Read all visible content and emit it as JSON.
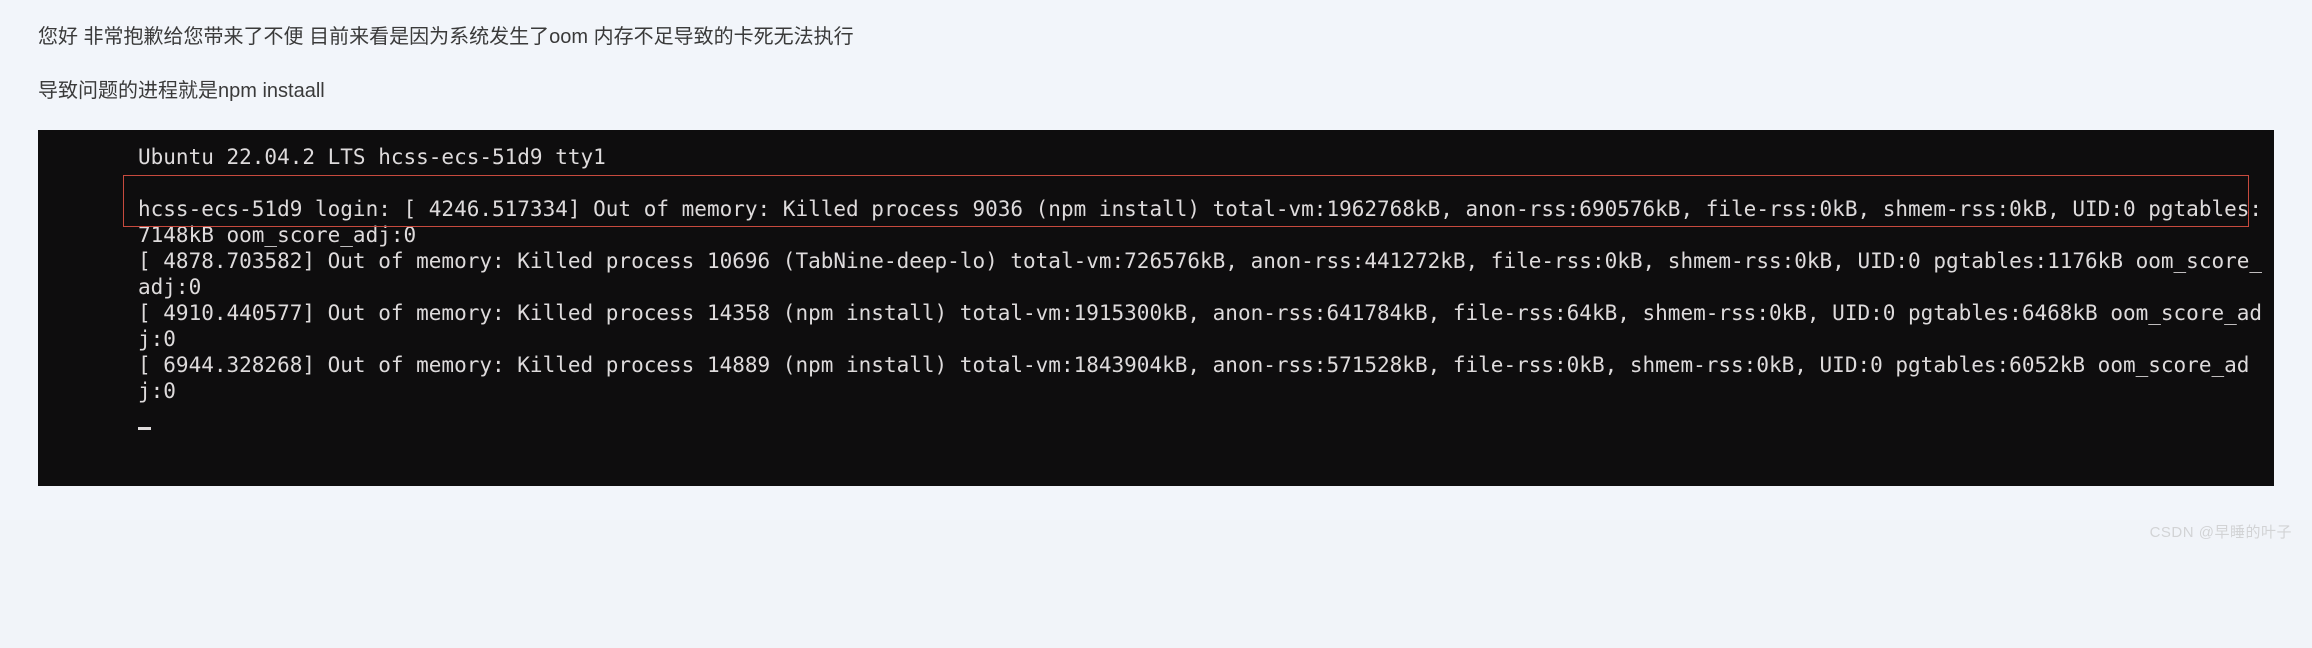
{
  "paragraphs": {
    "p1": "您好  非常抱歉给您带来了不便  目前来看是因为系统发生了oom  内存不足导致的卡死无法执行",
    "p2": "导致问题的进程就是npm instaall"
  },
  "terminal": {
    "l0": "Ubuntu 22.04.2 LTS hcss-ecs-51d9 tty1",
    "blank0": " ",
    "l1": "hcss-ecs-51d9 login: [ 4246.517334] Out of memory: Killed process 9036 (npm install) total-vm:1962768kB, anon-rss:690576kB, file-rss:0kB, shmem-rss:0kB, UID:0 pgtables:7148kB oom_score_adj:0",
    "l2": "[ 4878.703582] Out of memory: Killed process 10696 (TabNine-deep-lo) total-vm:726576kB, anon-rss:441272kB, file-rss:0kB, shmem-rss:0kB, UID:0 pgtables:1176kB oom_score_adj:0",
    "l3": "[ 4910.440577] Out of memory: Killed process 14358 (npm install) total-vm:1915300kB, anon-rss:641784kB, file-rss:64kB, shmem-rss:0kB, UID:0 pgtables:6468kB oom_score_adj:0",
    "l4": "[ 6944.328268] Out of memory: Killed process 14889 (npm install) total-vm:1843904kB, anon-rss:571528kB, file-rss:0kB, shmem-rss:0kB, UID:0 pgtables:6052kB oom_score_adj:0"
  },
  "watermark": "CSDN @早睡的叶子"
}
